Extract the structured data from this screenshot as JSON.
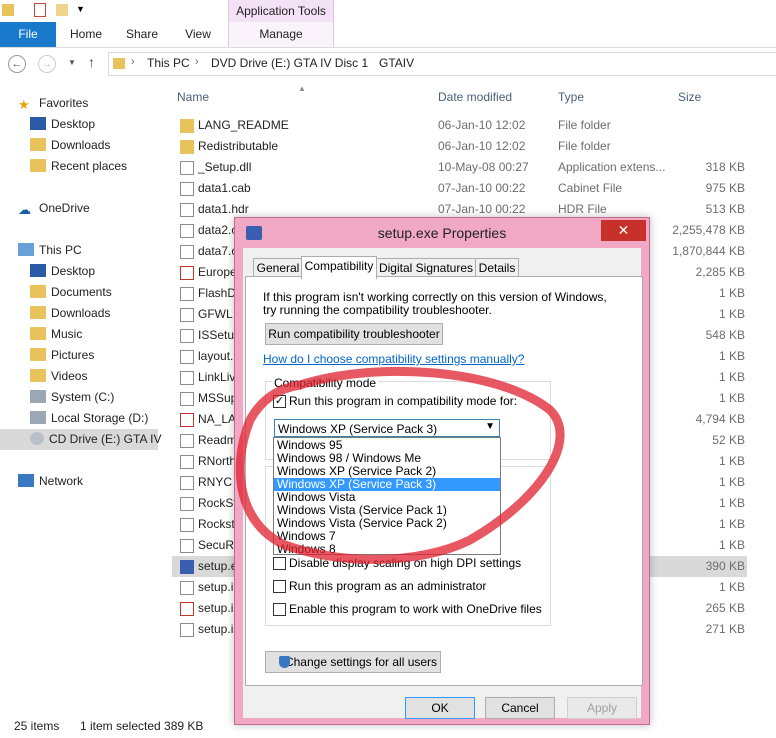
{
  "quick_access": {
    "context_group_label": "Application Tools"
  },
  "ribbon": {
    "tabs": [
      {
        "label": "File"
      },
      {
        "label": "Home"
      },
      {
        "label": "Share"
      },
      {
        "label": "View"
      },
      {
        "label": "Manage"
      }
    ]
  },
  "address": {
    "breadcrumbs": [
      "This PC",
      "DVD Drive (E:) GTA IV Disc 1",
      "GTAIV"
    ]
  },
  "nav": {
    "favorites": "Favorites",
    "fav_items": [
      "Desktop",
      "Downloads",
      "Recent places"
    ],
    "onedrive": "OneDrive",
    "thispc": "This PC",
    "pc_items": [
      "Desktop",
      "Documents",
      "Downloads",
      "Music",
      "Pictures",
      "Videos",
      "System (C:)",
      "Local Storage (D:)",
      "CD Drive (E:) GTA IV"
    ],
    "network": "Network"
  },
  "columns": {
    "name": "Name",
    "date": "Date modified",
    "type": "Type",
    "size": "Size"
  },
  "files": [
    {
      "name": "LANG_README",
      "date": "06-Jan-10 12:02",
      "type": "File folder",
      "size": "",
      "icon": "folder-icon"
    },
    {
      "name": "Redistributable",
      "date": "06-Jan-10 12:02",
      "type": "File folder",
      "size": "",
      "icon": "folder-icon"
    },
    {
      "name": "_Setup.dll",
      "date": "10-May-08 00:27",
      "type": "Application extens...",
      "size": "318 KB",
      "icon": "file-icon"
    },
    {
      "name": "data1.cab",
      "date": "07-Jan-10 00:22",
      "type": "Cabinet File",
      "size": "975 KB",
      "icon": "file-icon"
    },
    {
      "name": "data1.hdr",
      "date": "07-Jan-10 00:22",
      "type": "HDR File",
      "size": "513 KB",
      "icon": "file-icon"
    },
    {
      "name": "data2.c",
      "date": "",
      "type": "",
      "size": "2,255,478 KB",
      "icon": "file-icon"
    },
    {
      "name": "data7.c",
      "date": "",
      "type": "",
      "size": "1,870,844 KB",
      "icon": "file-icon"
    },
    {
      "name": "Europe",
      "date": "",
      "type": "",
      "size": "2,285 KB",
      "icon": "pdf-icon"
    },
    {
      "name": "FlashDe",
      "date": "",
      "type": "",
      "size": "1 KB",
      "icon": "shortcut-icon"
    },
    {
      "name": "GFWL",
      "date": "",
      "type": "",
      "size": "1 KB",
      "icon": "shortcut-icon"
    },
    {
      "name": "ISSetup",
      "date": "",
      "type": "",
      "size": "548 KB",
      "icon": "file-icon"
    },
    {
      "name": "layout.",
      "date": "",
      "type": "",
      "size": "1 KB",
      "icon": "file-icon"
    },
    {
      "name": "LinkLiv",
      "date": "",
      "type": "",
      "size": "1 KB",
      "icon": "shortcut-icon"
    },
    {
      "name": "MSSup",
      "date": "",
      "type": "",
      "size": "1 KB",
      "icon": "shortcut-icon"
    },
    {
      "name": "NA_LA",
      "date": "",
      "type": "",
      "size": "4,794 KB",
      "icon": "pdf-icon"
    },
    {
      "name": "Readm",
      "date": "",
      "type": "",
      "size": "52 KB",
      "icon": "file-icon"
    },
    {
      "name": "RNorth",
      "date": "",
      "type": "",
      "size": "1 KB",
      "icon": "shortcut-icon"
    },
    {
      "name": "RNYC",
      "date": "",
      "type": "",
      "size": "1 KB",
      "icon": "shortcut-icon"
    },
    {
      "name": "RockSt",
      "date": "",
      "type": "",
      "size": "1 KB",
      "icon": "shortcut-icon"
    },
    {
      "name": "Rocksta",
      "date": "",
      "type": "",
      "size": "1 KB",
      "icon": "shortcut-icon"
    },
    {
      "name": "SecuRC",
      "date": "",
      "type": "",
      "size": "1 KB",
      "icon": "shortcut-icon"
    },
    {
      "name": "setup.e",
      "date": "",
      "type": "",
      "size": "390 KB",
      "icon": "app-icon"
    },
    {
      "name": "setup.in",
      "date": "",
      "type": "",
      "size": "1 KB",
      "icon": "file-icon"
    },
    {
      "name": "setup.in",
      "date": "",
      "type": "",
      "size": "265 KB",
      "icon": "pdf-icon"
    },
    {
      "name": "setup.is",
      "date": "",
      "type": "",
      "size": "271 KB",
      "icon": "file-icon"
    }
  ],
  "status": {
    "count": "25 items",
    "selection": "1 item selected  389 KB"
  },
  "dialog": {
    "title": "setup.exe Properties",
    "close": "✕",
    "tabs": [
      "General",
      "Compatibility",
      "Digital Signatures",
      "Details"
    ],
    "intro": "If this program isn't working correctly on this version of Windows,",
    "intro2": "try running the compatibility troubleshooter.",
    "troubleshoot_btn": "Run compatibility troubleshooter",
    "manual_link": "How do I choose compatibility settings manually?",
    "compat_group": "Compatibility mode",
    "compat_check": "Run this program in compatibility mode for:",
    "compat_selected": "Windows XP (Service Pack 3)",
    "options": [
      "Windows 95",
      "Windows 98 / Windows Me",
      "Windows XP (Service Pack 2)",
      "Windows XP (Service Pack 3)",
      "Windows Vista",
      "Windows Vista (Service Pack 1)",
      "Windows Vista (Service Pack 2)",
      "Windows 7",
      "Windows 8"
    ],
    "dpi_check": "Disable display scaling on high DPI settings",
    "admin_check": "Run this program as an administrator",
    "onedrive_check": "Enable this program to work with OneDrive files",
    "all_users_btn": "Change settings for all users",
    "ok": "OK",
    "cancel": "Cancel",
    "apply": "Apply"
  },
  "colors": {
    "accent": "#1979ca",
    "dialog_frame": "#f0a8c4",
    "close_red": "#c7302b",
    "annotation": "#e0202e"
  }
}
